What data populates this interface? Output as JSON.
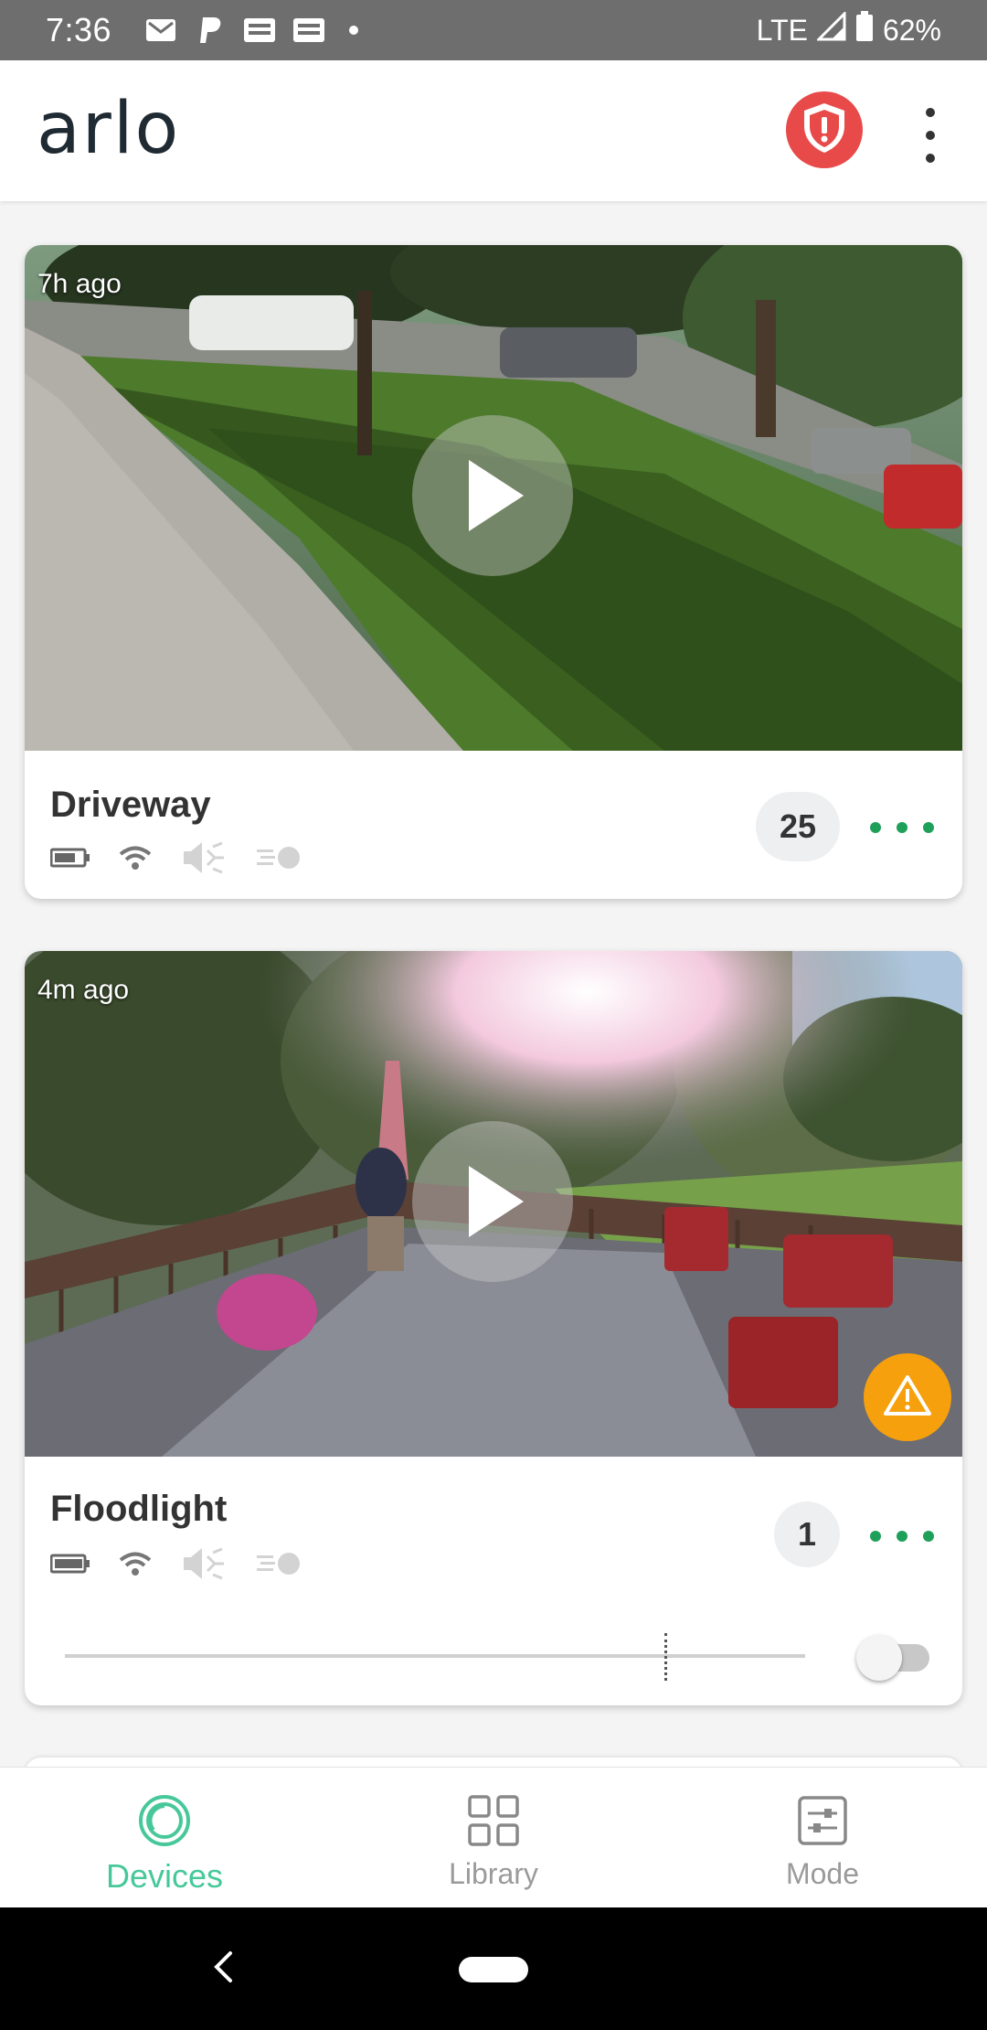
{
  "status_bar": {
    "time": "7:36",
    "network": "LTE",
    "battery": "62%",
    "icons_left": [
      "gmail-icon",
      "paypal-icon",
      "ge-icon",
      "ge-icon",
      "dot-icon"
    ]
  },
  "app_bar": {
    "logo": "arlo",
    "shield_color": "#e84a4a"
  },
  "cameras": [
    {
      "name": "Driveway",
      "last_seen": "7h ago",
      "clip_count": "25",
      "status_icons": [
        "battery-icon",
        "wifi-icon",
        "speaker-muted-icon",
        "motion-icon"
      ]
    },
    {
      "name": "Floodlight",
      "last_seen": "4m ago",
      "clip_count": "1",
      "status_icons": [
        "battery-icon",
        "wifi-icon",
        "speaker-muted-icon",
        "motion-icon"
      ],
      "alert_icon": "warning-icon",
      "floodlight_toggle": false
    }
  ],
  "bottom_nav": {
    "items": [
      {
        "label": "Devices",
        "icon": "devices-icon",
        "active": true
      },
      {
        "label": "Library",
        "icon": "library-icon",
        "active": false
      },
      {
        "label": "Mode",
        "icon": "mode-icon",
        "active": false
      }
    ]
  },
  "colors": {
    "accent": "#47c89a",
    "more_dots": "#1fa05a",
    "warning": "#f6a00e"
  }
}
